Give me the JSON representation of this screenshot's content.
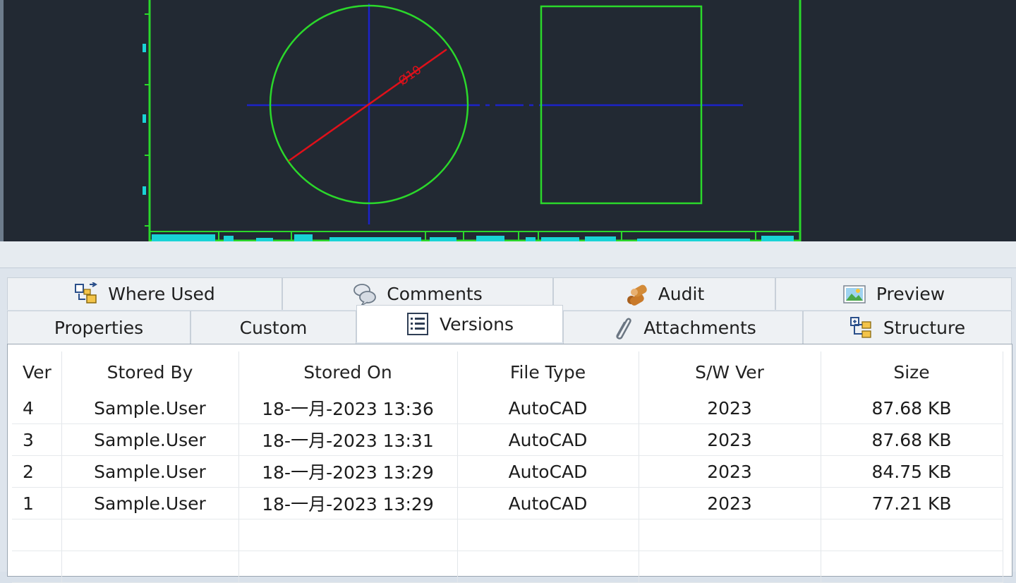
{
  "drawing": {
    "dimension_label": "Ø10",
    "colors": {
      "background": "#222933",
      "outline": "#2bd82b",
      "centerline": "#1c23c8",
      "dimension": "#e0101a",
      "titleblock": "#19d3d6"
    }
  },
  "tabs": {
    "row1": [
      {
        "label": "Where Used",
        "icon": "where-used-icon"
      },
      {
        "label": "Comments",
        "icon": "comments-icon"
      },
      {
        "label": "Audit",
        "icon": "audit-icon"
      },
      {
        "label": "Preview",
        "icon": "preview-icon"
      }
    ],
    "row2": [
      {
        "label": "Properties",
        "icon": ""
      },
      {
        "label": "Custom",
        "icon": ""
      },
      {
        "label": "Versions",
        "icon": "versions-icon",
        "active": true
      },
      {
        "label": "Attachments",
        "icon": "paperclip-icon"
      },
      {
        "label": "Structure",
        "icon": "structure-icon"
      }
    ]
  },
  "versions": {
    "columns": [
      "Ver",
      "Stored By",
      "Stored On",
      "File Type",
      "S/W Ver",
      "Size"
    ],
    "rows": [
      [
        "4",
        "Sample.User",
        "18-一月-2023 13:36",
        "AutoCAD",
        "2023",
        "87.68 KB"
      ],
      [
        "3",
        "Sample.User",
        "18-一月-2023 13:31",
        "AutoCAD",
        "2023",
        "87.68 KB"
      ],
      [
        "2",
        "Sample.User",
        "18-一月-2023 13:29",
        "AutoCAD",
        "2023",
        "84.75 KB"
      ],
      [
        "1",
        "Sample.User",
        "18-一月-2023 13:29",
        "AutoCAD",
        "2023",
        "77.21 KB"
      ]
    ]
  }
}
